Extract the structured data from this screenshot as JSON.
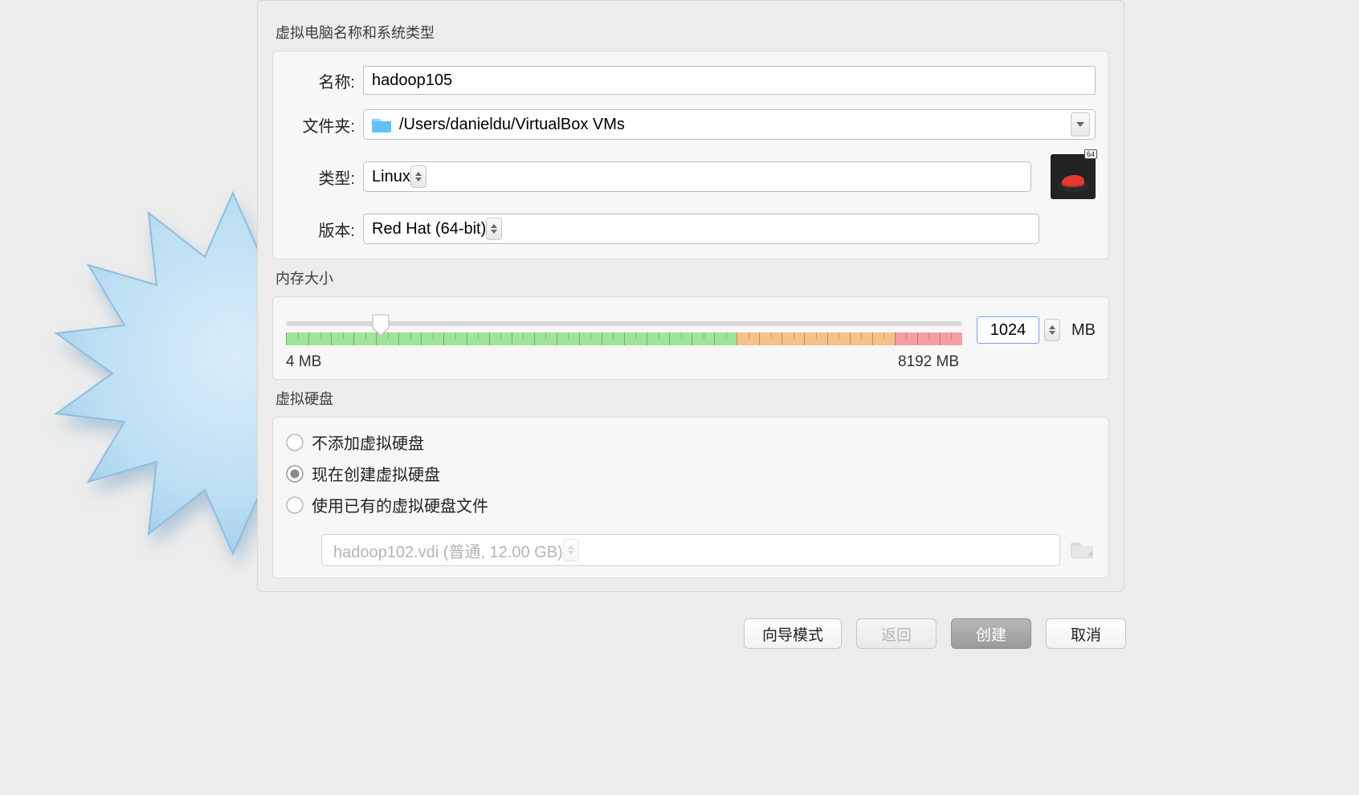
{
  "sections": {
    "nameType": {
      "title": "虚拟电脑名称和系统类型",
      "nameLabel": "名称:",
      "nameValue": "hadoop105",
      "folderLabel": "文件夹:",
      "folderValue": "/Users/danieldu/VirtualBox VMs",
      "typeLabel": "类型:",
      "typeValue": "Linux",
      "versionLabel": "版本:",
      "versionValue": "Red Hat (64-bit)",
      "osBadge": "64"
    },
    "memory": {
      "title": "内存大小",
      "value": "1024",
      "unit": "MB",
      "min": "4 MB",
      "max": "8192 MB",
      "sliderPercent": 14
    },
    "disk": {
      "title": "虚拟硬盘",
      "options": [
        "不添加虚拟硬盘",
        "现在创建虚拟硬盘",
        "使用已有的虚拟硬盘文件"
      ],
      "selectedIndex": 1,
      "existingFile": "hadoop102.vdi (普通, 12.00 GB)"
    }
  },
  "buttons": {
    "expert": "向导模式",
    "back": "返回",
    "create": "创建",
    "cancel": "取消"
  }
}
